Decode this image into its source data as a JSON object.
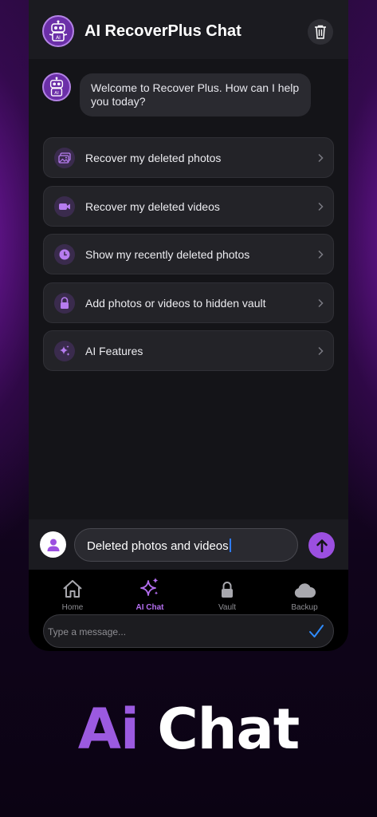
{
  "header": {
    "title": "AI RecoverPlus Chat",
    "bot_icon": "robot-icon",
    "trash_icon": "trash-icon"
  },
  "chat": {
    "welcome_message": "Welcome to Recover Plus. How can I help you today?"
  },
  "options": [
    {
      "label": "Recover my deleted photos",
      "icon": "photos-icon"
    },
    {
      "label": "Recover my deleted videos",
      "icon": "video-camera-icon"
    },
    {
      "label": "Show my recently deleted photos",
      "icon": "clock-icon"
    },
    {
      "label": "Add photos or videos to hidden vault",
      "icon": "lock-icon"
    },
    {
      "label": "AI Features",
      "icon": "sparkles-icon"
    }
  ],
  "input": {
    "value": "Deleted photos and videos",
    "send_icon": "arrow-up-icon",
    "user_icon": "user-icon"
  },
  "tabs": [
    {
      "label": "Home",
      "icon": "home-icon",
      "active": false
    },
    {
      "label": "AI Chat",
      "icon": "sparkles-icon",
      "active": true
    },
    {
      "label": "Vault",
      "icon": "lock-icon",
      "active": false
    },
    {
      "label": "Backup",
      "icon": "cloud-icon",
      "active": false
    }
  ],
  "message_field": {
    "placeholder": "Type a message..."
  },
  "promo": {
    "word1": "Ai",
    "word2": "Chat"
  },
  "colors": {
    "accent": "#9b4fe0",
    "background": "#141418",
    "caret": "#2f7bff"
  }
}
